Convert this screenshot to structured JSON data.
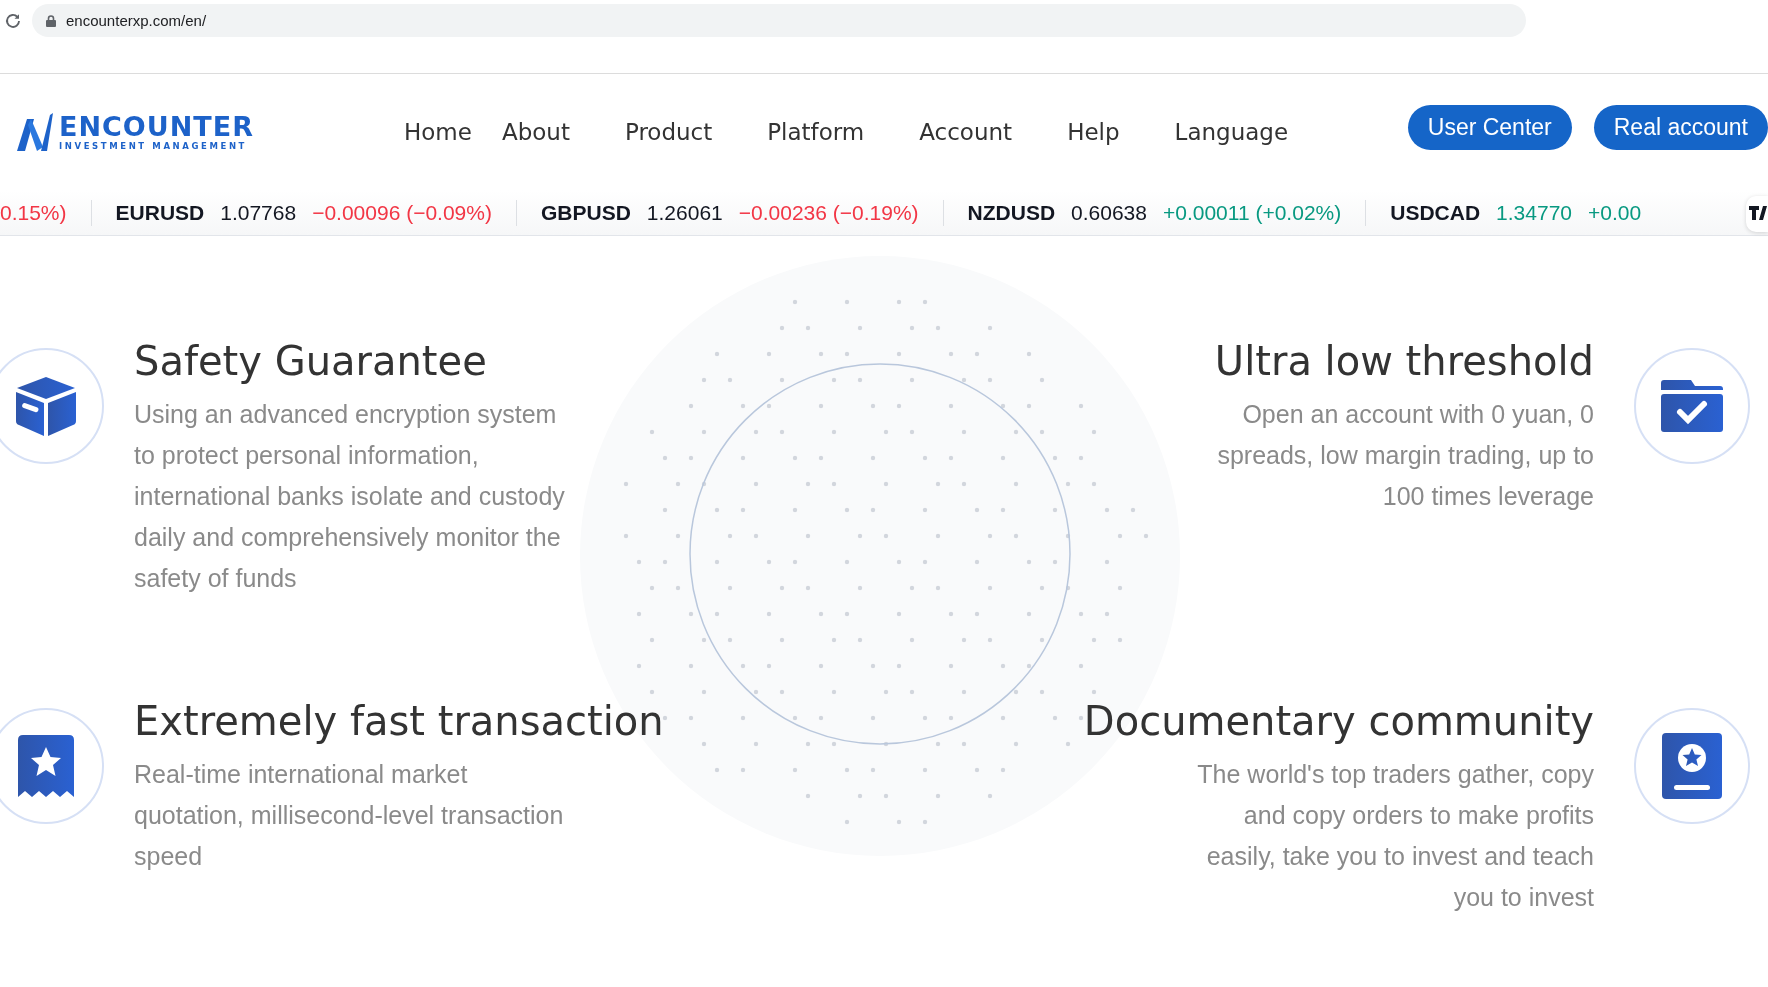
{
  "browser": {
    "url": "encounterxp.com/en/"
  },
  "brand": {
    "name": "ENCOUNTER",
    "tagline": "INVESTMENT MANAGEMENT"
  },
  "nav": [
    "Home",
    "About",
    "Product",
    "Platform",
    "Account",
    "Help",
    "Language"
  ],
  "buttons": [
    "User Center",
    "Real account"
  ],
  "ticker": [
    {
      "change": "0.15%)",
      "kind": "down"
    },
    {
      "symbol": "EURUSD",
      "price": "1.07768",
      "change": "−0.00096 (−0.09%)",
      "kind": "down"
    },
    {
      "symbol": "GBPUSD",
      "price": "1.26061",
      "change": "−0.00236 (−0.19%)",
      "kind": "down"
    },
    {
      "symbol": "NZDUSD",
      "price": "0.60638",
      "change": "+0.00011 (+0.02%)",
      "kind": "up"
    },
    {
      "symbol": "USDCAD",
      "price": "1.34770",
      "change": "+0.00",
      "kind": "up"
    }
  ],
  "features": [
    {
      "title": "Safety Guarantee",
      "text": "Using an advanced encryption system to protect personal information, international banks isolate and custody daily and comprehensively monitor the safety of funds"
    },
    {
      "title": "Ultra low threshold",
      "text": "Open an account with 0 yuan, 0 spreads, low margin trading, up to 100 times leverage"
    },
    {
      "title": "Extremely fast transaction",
      "text": "Real-time international market quotation, millisecond-level transaction speed"
    },
    {
      "title": "Documentary community",
      "text": "The world's top traders gather, copy and copy orders to make profits easily, take you to invest and teach you to invest"
    }
  ]
}
